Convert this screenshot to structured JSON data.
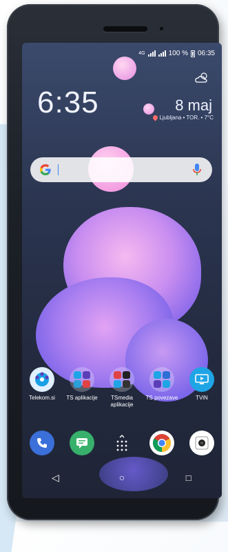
{
  "status_bar": {
    "network": "4G",
    "battery_percent": "100 %",
    "time": "06:35"
  },
  "clock_widget": {
    "time": "6:35",
    "date": "8 maj",
    "location": "Ljubljana",
    "weather_summary": "• TOR. • 7°C"
  },
  "search_bar": {
    "logo": "G",
    "mic_icon": "mic-icon"
  },
  "home_apps": [
    {
      "label": "Telekom.si",
      "icon": "telekom-icon"
    },
    {
      "label": "TS aplikacije",
      "icon": "folder-icon"
    },
    {
      "label": "TSmedia aplikacije",
      "icon": "folder-icon"
    },
    {
      "label": "TS povezave",
      "icon": "folder-icon"
    },
    {
      "label": "TViN",
      "icon": "tv-icon"
    }
  ],
  "dock": [
    {
      "name": "phone",
      "icon": "phone-icon"
    },
    {
      "name": "messages",
      "icon": "message-icon"
    },
    {
      "name": "app-drawer",
      "icon": "grid-dots-icon"
    },
    {
      "name": "chrome",
      "icon": "chrome-icon"
    },
    {
      "name": "camera",
      "icon": "camera-icon"
    }
  ],
  "nav_bar": {
    "back": "◁",
    "home": "○",
    "recents": "□"
  }
}
